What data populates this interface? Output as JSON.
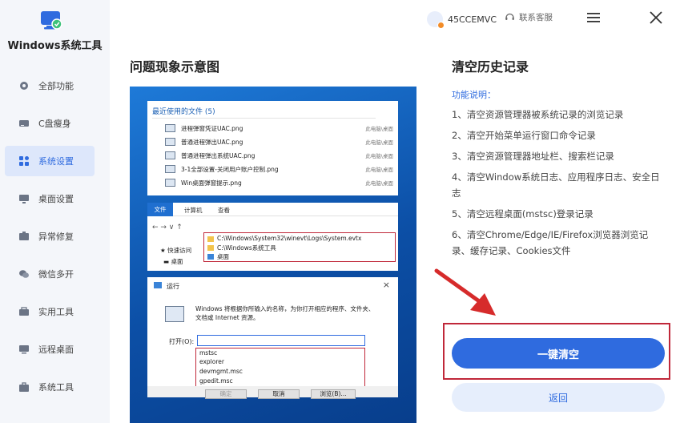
{
  "app": {
    "title": "Windows系统工具"
  },
  "sidebar": {
    "items": [
      {
        "label": "全部功能",
        "icon": "gear-icon",
        "active": false
      },
      {
        "label": "C盘瘦身",
        "icon": "disk-icon",
        "active": false
      },
      {
        "label": "系统设置",
        "icon": "grid-icon",
        "active": true
      },
      {
        "label": "桌面设置",
        "icon": "desktop-icon",
        "active": false
      },
      {
        "label": "异常修复",
        "icon": "wrench-icon",
        "active": false
      },
      {
        "label": "微信多开",
        "icon": "wechat-icon",
        "active": false
      },
      {
        "label": "实用工具",
        "icon": "toolbox-icon",
        "active": false
      },
      {
        "label": "远程桌面",
        "icon": "remote-icon",
        "active": false
      },
      {
        "label": "系统工具",
        "icon": "briefcase-icon",
        "active": false
      }
    ]
  },
  "topbar": {
    "username": "45CCEMVC",
    "support_label": "联系客服"
  },
  "main": {
    "left_title": "问题现象示意图",
    "right_title": "清空历史记录",
    "feature_heading": "功能说明：",
    "features": [
      "1、清空资源管理器被系统记录的浏览记录",
      "2、清空开始菜单运行窗口命令记录",
      "3、清空资源管理器地址栏、搜索栏记录",
      "4、清空Window系统日志、应用程序日志、安全日志",
      "5、清空远程桌面(mstsc)登录记录",
      "6、清空Chrome/Edge/IE/Firefox浏览器浏览记录、缓存记录、Cookies文件"
    ],
    "primary_button": "一键清空",
    "back_button": "返回"
  },
  "illustration": {
    "recent_header": "最近使用的文件 (5)",
    "recent_files": [
      {
        "name": "进程弹窗凭证UAC.png",
        "location": "此电脑\\桌面"
      },
      {
        "name": "普通进程弹出UAC.png",
        "location": "此电脑\\桌面"
      },
      {
        "name": "普通进程弹出系统UAC.png",
        "location": "此电脑\\桌面"
      },
      {
        "name": "3-1全部设置-关闭用户账户控制.png",
        "location": "此电脑\\桌面"
      },
      {
        "name": "Win桌面弹窗提示.png",
        "location": "此电脑\\桌面"
      }
    ],
    "explorer_tabs": [
      "文件",
      "计算机",
      "查看"
    ],
    "quick_access": "快速访问",
    "desktop": "桌面",
    "address_history": [
      "C:\\Windows\\System32\\winevt\\Logs\\System.evtx",
      "C:\\Windows系统工具",
      "桌面"
    ],
    "run_title": "运行",
    "run_description": "Windows 将根据你所输入的名称，为你打开相应的程序、文件夹、文档或 Internet 资源。",
    "run_open_label": "打开(O):",
    "run_history": [
      "mstsc",
      "explorer",
      "devmgmt.msc",
      "gpedit.msc"
    ],
    "run_buttons": [
      "确定",
      "取消",
      "浏览(B)..."
    ]
  },
  "colors": {
    "accent": "#2f6bdf",
    "highlight": "#c0283a",
    "illus_bg": "#0f5bb8"
  }
}
